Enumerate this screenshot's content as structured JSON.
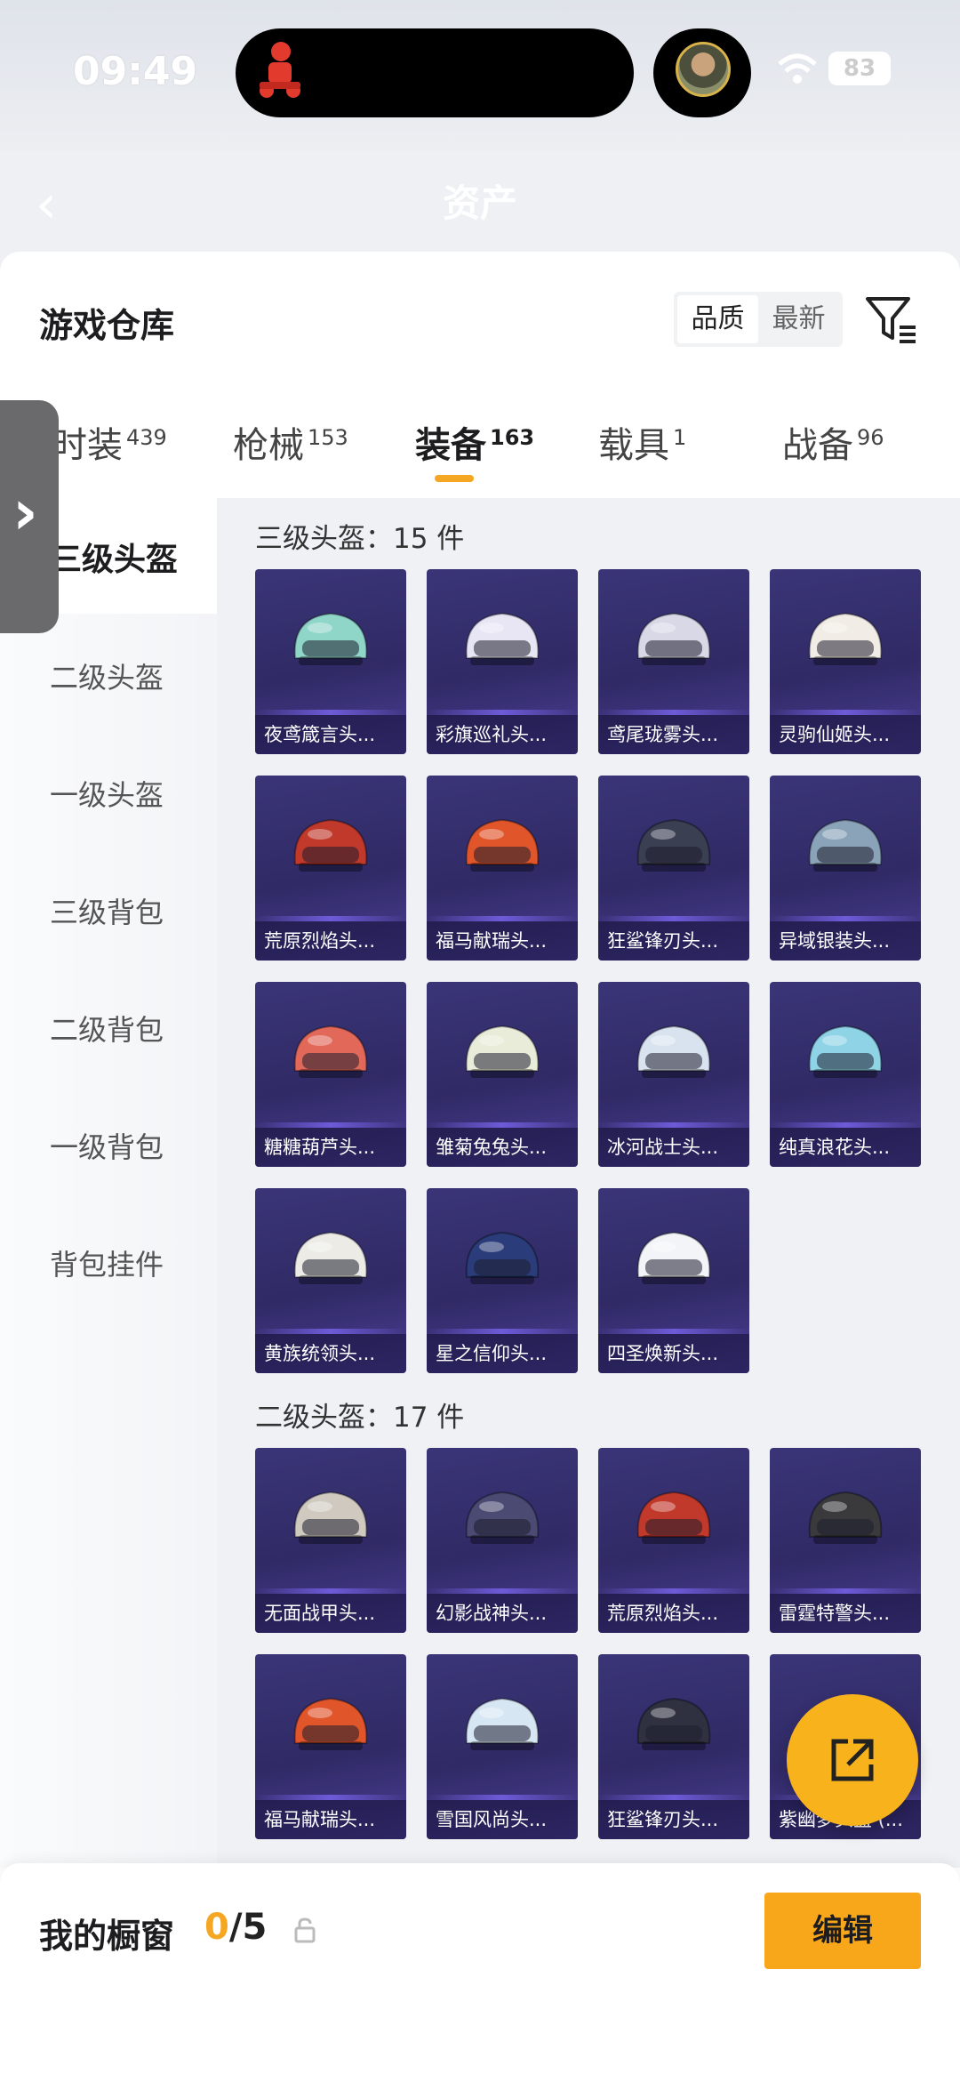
{
  "status_bar": {
    "time": "09:49",
    "battery": "83"
  },
  "header": {
    "title": "资产"
  },
  "sheet": {
    "title": "游戏仓库",
    "sort_options": [
      {
        "label": "品质",
        "active": true
      },
      {
        "label": "最新",
        "active": false
      }
    ]
  },
  "tabs": [
    {
      "label": "时装",
      "count": "439"
    },
    {
      "label": "枪械",
      "count": "153"
    },
    {
      "label": "装备",
      "count": "163",
      "active": true
    },
    {
      "label": "载具",
      "count": "1"
    },
    {
      "label": "战备",
      "count": "96"
    }
  ],
  "sidebar": [
    {
      "label": "三级头盔",
      "active": true
    },
    {
      "label": "二级头盔"
    },
    {
      "label": "一级头盔"
    },
    {
      "label": "三级背包"
    },
    {
      "label": "二级背包"
    },
    {
      "label": "一级背包"
    },
    {
      "label": "背包挂件"
    }
  ],
  "sections": [
    {
      "title": "三级头盔：15 件",
      "items": [
        {
          "name": "夜鸢箴言头...",
          "color": "#8fd6c9"
        },
        {
          "name": "彩旗巡礼头...",
          "color": "#e8e6f4"
        },
        {
          "name": "鸢尾珑雾头...",
          "color": "#d8d8e6"
        },
        {
          "name": "灵驹仙姬头...",
          "color": "#f1ede6"
        },
        {
          "name": "荒原烈焰头...",
          "color": "#c0392b"
        },
        {
          "name": "福马献瑞头...",
          "color": "#e0552a"
        },
        {
          "name": "狂鲨锋刃头...",
          "color": "#3b3f52"
        },
        {
          "name": "异域银装头...",
          "color": "#8aa3b8"
        },
        {
          "name": "糖糖葫芦头...",
          "color": "#e2685a"
        },
        {
          "name": "雏菊兔兔头...",
          "color": "#e9ecd9"
        },
        {
          "name": "冰河战士头...",
          "color": "#d9e3ef"
        },
        {
          "name": "纯真浪花头...",
          "color": "#8ed3e6"
        },
        {
          "name": "黄族统领头...",
          "color": "#ecebe6"
        },
        {
          "name": "星之信仰头...",
          "color": "#2b3c7a"
        },
        {
          "name": "四圣焕新头...",
          "color": "#f2f4f8"
        }
      ]
    },
    {
      "title": "二级头盔：17 件",
      "items": [
        {
          "name": "无面战甲头...",
          "color": "#cfc9c0"
        },
        {
          "name": "幻影战神头...",
          "color": "#4b4a72"
        },
        {
          "name": "荒原烈焰头...",
          "color": "#c0392b"
        },
        {
          "name": "雷霆特警头...",
          "color": "#3a3a3c"
        },
        {
          "name": "福马献瑞头...",
          "color": "#e0552a"
        },
        {
          "name": "雪国风尚头...",
          "color": "#d7e6f3"
        },
        {
          "name": "狂鲨锋刃头...",
          "color": "#2f3140"
        },
        {
          "name": "紫幽梦头盔 (...",
          "color": "#6d4f9e"
        }
      ]
    }
  ],
  "showcase": {
    "label": "我的橱窗",
    "current": "0",
    "total": "/5",
    "edit_label": "编辑"
  }
}
